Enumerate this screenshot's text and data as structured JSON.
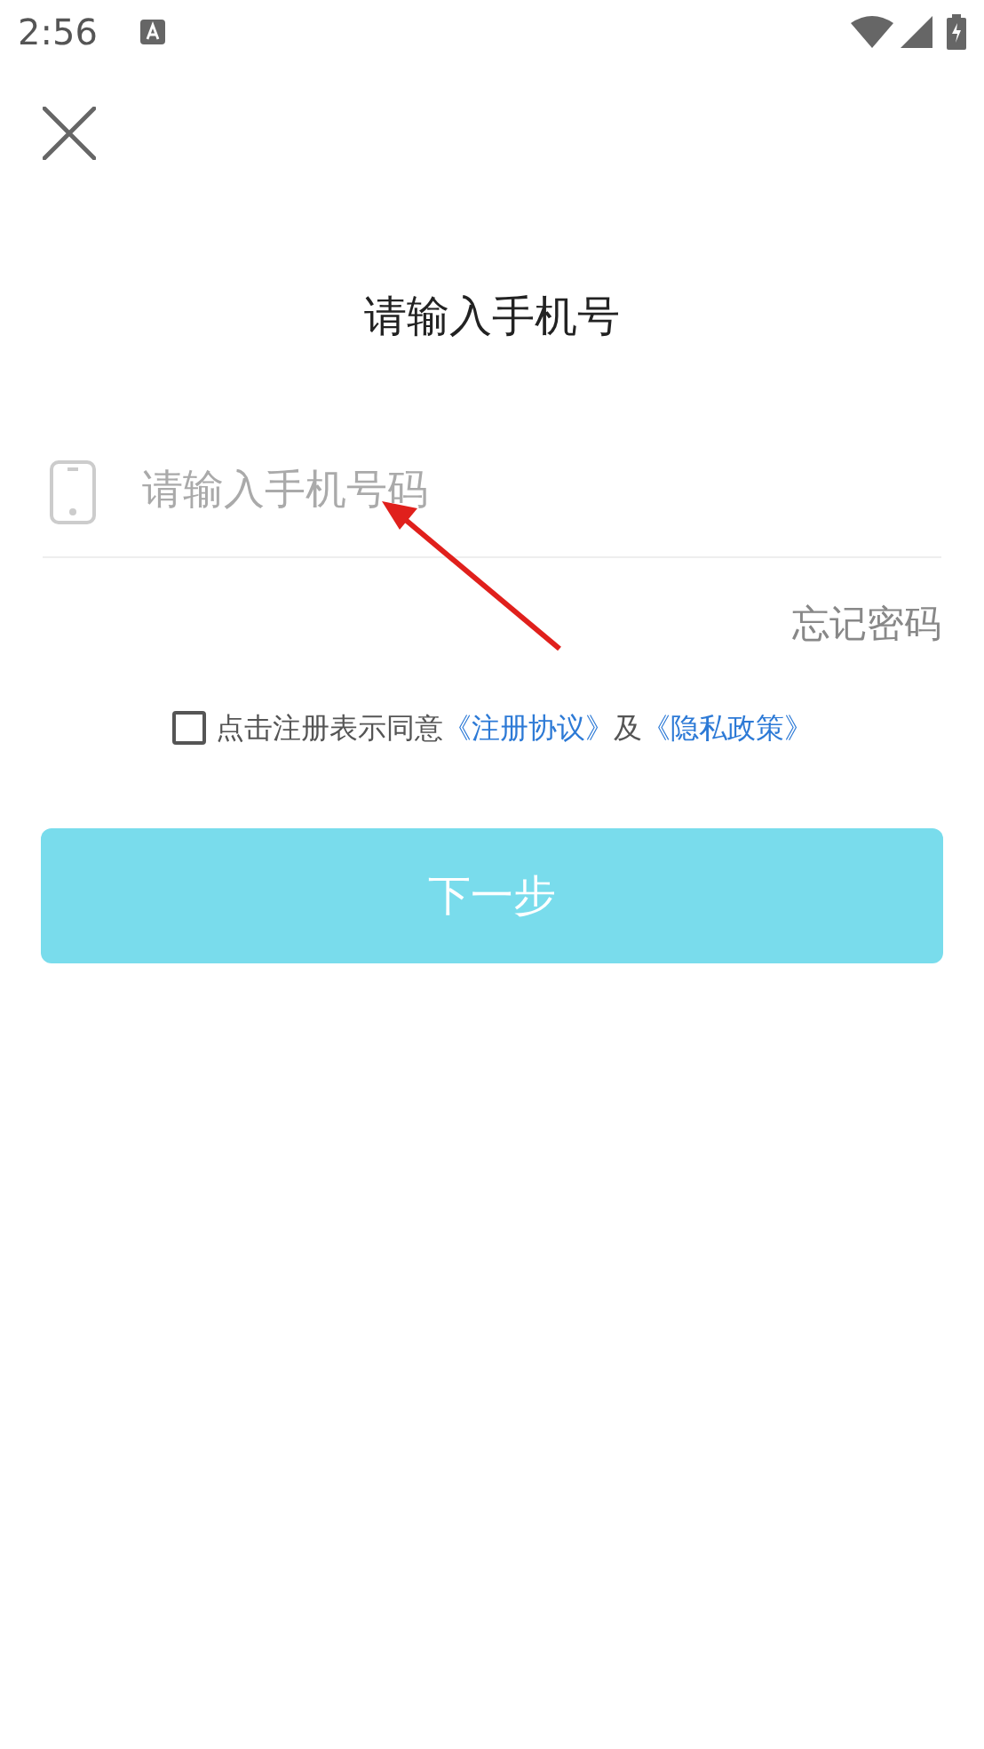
{
  "status_bar": {
    "time": "2:56"
  },
  "title": "请输入手机号",
  "phone_field": {
    "placeholder": "请输入手机号码"
  },
  "forgot_password": "忘记密码",
  "agreement": {
    "checked": false,
    "text": "点击注册表示同意",
    "link_1": "《注册协议》",
    "joiner": "及",
    "link_2": "《隐私政策》"
  },
  "next_button": {
    "label": "下一步",
    "disabled": true
  }
}
